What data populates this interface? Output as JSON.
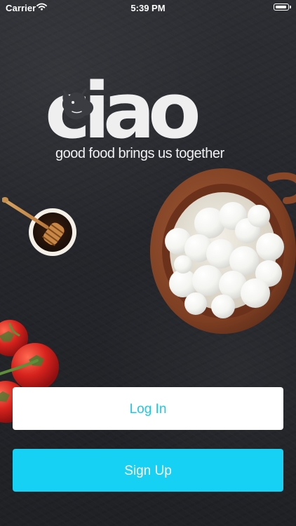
{
  "status_bar": {
    "carrier": "Carrier",
    "time": "5:39 PM",
    "wifi_icon": "wifi-icon",
    "battery_icon": "battery-icon"
  },
  "brand": {
    "logo_text": "ciao",
    "tagline": "good food brings us together",
    "logo_icon": "cow-icon",
    "logo_color": "#efeff0"
  },
  "illustrations": {
    "honey": "honey-dipper-icon",
    "tomatoes": "tomatoes-icon",
    "cheese_bowl": "mozzarella-bowl-icon"
  },
  "actions": {
    "login_label": "Log In",
    "signup_label": "Sign Up",
    "accent": "#16d1f4"
  }
}
